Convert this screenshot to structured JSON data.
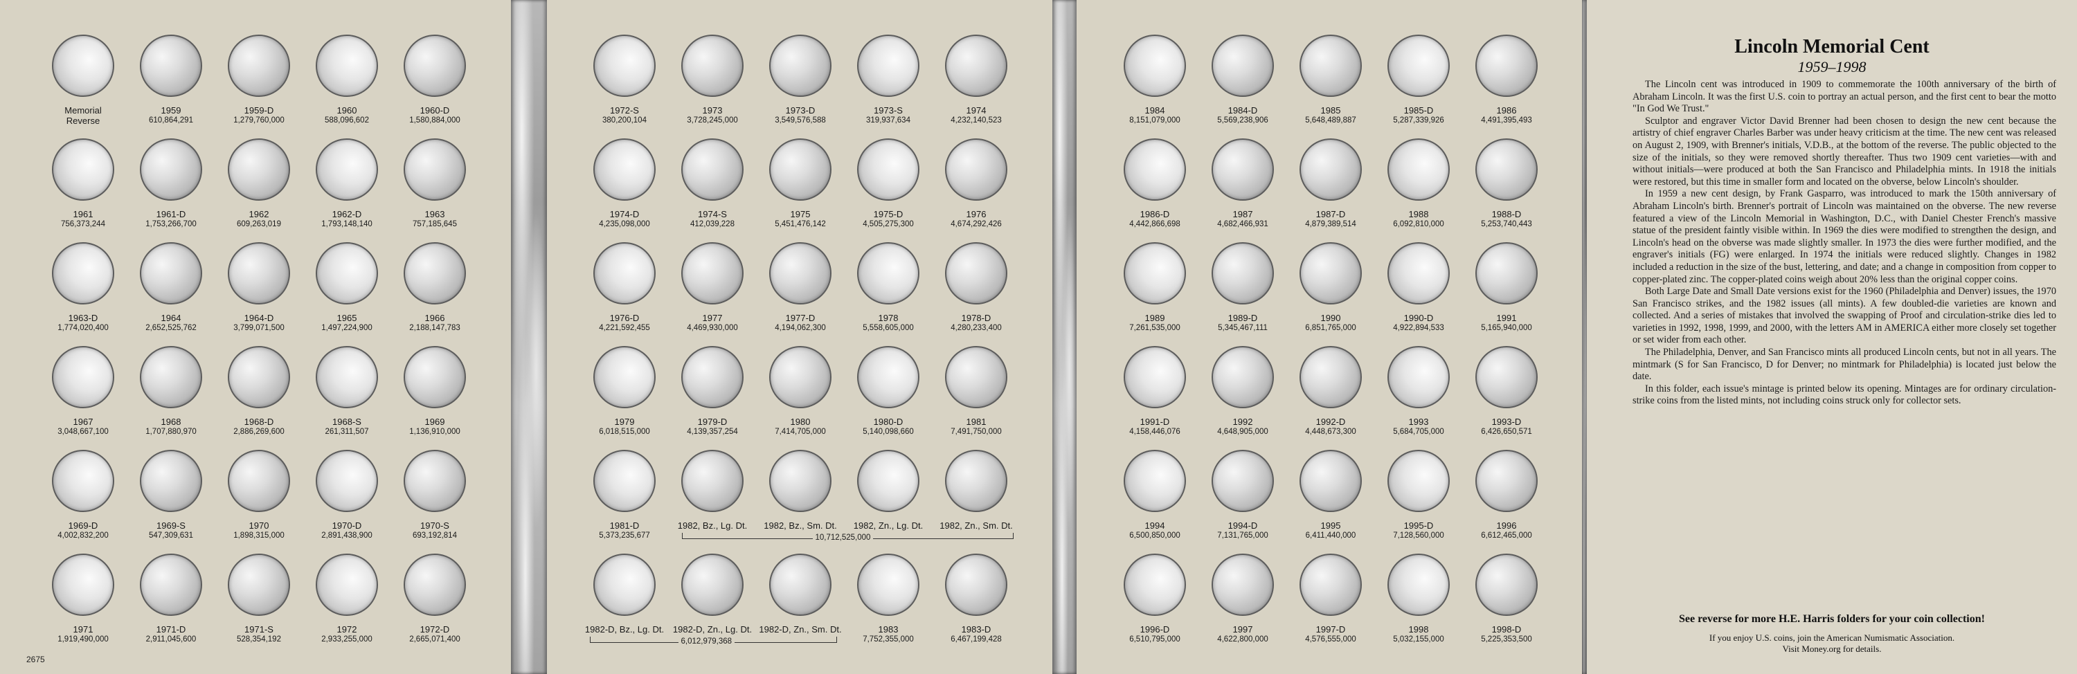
{
  "page_number": "2675",
  "panel1": [
    {
      "label": "Memorial\nReverse",
      "mintage": ""
    },
    {
      "label": "1959",
      "mintage": "610,864,291"
    },
    {
      "label": "1959-D",
      "mintage": "1,279,760,000"
    },
    {
      "label": "1960",
      "mintage": "588,096,602"
    },
    {
      "label": "1960-D",
      "mintage": "1,580,884,000"
    },
    {
      "label": "1961",
      "mintage": "756,373,244"
    },
    {
      "label": "1961-D",
      "mintage": "1,753,266,700"
    },
    {
      "label": "1962",
      "mintage": "609,263,019"
    },
    {
      "label": "1962-D",
      "mintage": "1,793,148,140"
    },
    {
      "label": "1963",
      "mintage": "757,185,645"
    },
    {
      "label": "1963-D",
      "mintage": "1,774,020,400"
    },
    {
      "label": "1964",
      "mintage": "2,652,525,762"
    },
    {
      "label": "1964-D",
      "mintage": "3,799,071,500"
    },
    {
      "label": "1965",
      "mintage": "1,497,224,900"
    },
    {
      "label": "1966",
      "mintage": "2,188,147,783"
    },
    {
      "label": "1967",
      "mintage": "3,048,667,100"
    },
    {
      "label": "1968",
      "mintage": "1,707,880,970"
    },
    {
      "label": "1968-D",
      "mintage": "2,886,269,600"
    },
    {
      "label": "1968-S",
      "mintage": "261,311,507"
    },
    {
      "label": "1969",
      "mintage": "1,136,910,000"
    },
    {
      "label": "1969-D",
      "mintage": "4,002,832,200"
    },
    {
      "label": "1969-S",
      "mintage": "547,309,631"
    },
    {
      "label": "1970",
      "mintage": "1,898,315,000"
    },
    {
      "label": "1970-D",
      "mintage": "2,891,438,900"
    },
    {
      "label": "1970-S",
      "mintage": "693,192,814"
    },
    {
      "label": "1971",
      "mintage": "1,919,490,000"
    },
    {
      "label": "1971-D",
      "mintage": "2,911,045,600"
    },
    {
      "label": "1971-S",
      "mintage": "528,354,192"
    },
    {
      "label": "1972",
      "mintage": "2,933,255,000"
    },
    {
      "label": "1972-D",
      "mintage": "2,665,071,400"
    }
  ],
  "panel2": [
    {
      "label": "1972-S",
      "mintage": "380,200,104"
    },
    {
      "label": "1973",
      "mintage": "3,728,245,000"
    },
    {
      "label": "1973-D",
      "mintage": "3,549,576,588"
    },
    {
      "label": "1973-S",
      "mintage": "319,937,634"
    },
    {
      "label": "1974",
      "mintage": "4,232,140,523"
    },
    {
      "label": "1974-D",
      "mintage": "4,235,098,000"
    },
    {
      "label": "1974-S",
      "mintage": "412,039,228"
    },
    {
      "label": "1975",
      "mintage": "5,451,476,142"
    },
    {
      "label": "1975-D",
      "mintage": "4,505,275,300"
    },
    {
      "label": "1976",
      "mintage": "4,674,292,426"
    },
    {
      "label": "1976-D",
      "mintage": "4,221,592,455"
    },
    {
      "label": "1977",
      "mintage": "4,469,930,000"
    },
    {
      "label": "1977-D",
      "mintage": "4,194,062,300"
    },
    {
      "label": "1978",
      "mintage": "5,558,605,000"
    },
    {
      "label": "1978-D",
      "mintage": "4,280,233,400"
    },
    {
      "label": "1979",
      "mintage": "6,018,515,000"
    },
    {
      "label": "1979-D",
      "mintage": "4,139,357,254"
    },
    {
      "label": "1980",
      "mintage": "7,414,705,000"
    },
    {
      "label": "1980-D",
      "mintage": "5,140,098,660"
    },
    {
      "label": "1981",
      "mintage": "7,491,750,000"
    },
    {
      "label": "1981-D",
      "mintage": "5,373,235,677"
    },
    {
      "label": "1982, Bz., Lg. Dt.",
      "mintage": ""
    },
    {
      "label": "1982, Bz., Sm. Dt.",
      "mintage": ""
    },
    {
      "label": "1982, Zn., Lg. Dt.",
      "mintage": ""
    },
    {
      "label": "1982, Zn., Sm. Dt.",
      "mintage": ""
    },
    {
      "label": "1982-D, Bz., Lg. Dt.",
      "mintage": ""
    },
    {
      "label": "1982-D, Zn., Lg. Dt.",
      "mintage": ""
    },
    {
      "label": "1982-D, Zn., Sm. Dt.",
      "mintage": ""
    },
    {
      "label": "1983",
      "mintage": "7,752,355,000"
    },
    {
      "label": "1983-D",
      "mintage": "6,467,199,428"
    }
  ],
  "bracket_1982": "10,712,525,000",
  "bracket_1982d": "6,012,979,368",
  "panel3": [
    {
      "label": "1984",
      "mintage": "8,151,079,000"
    },
    {
      "label": "1984-D",
      "mintage": "5,569,238,906"
    },
    {
      "label": "1985",
      "mintage": "5,648,489,887"
    },
    {
      "label": "1985-D",
      "mintage": "5,287,339,926"
    },
    {
      "label": "1986",
      "mintage": "4,491,395,493"
    },
    {
      "label": "1986-D",
      "mintage": "4,442,866,698"
    },
    {
      "label": "1987",
      "mintage": "4,682,466,931"
    },
    {
      "label": "1987-D",
      "mintage": "4,879,389,514"
    },
    {
      "label": "1988",
      "mintage": "6,092,810,000"
    },
    {
      "label": "1988-D",
      "mintage": "5,253,740,443"
    },
    {
      "label": "1989",
      "mintage": "7,261,535,000"
    },
    {
      "label": "1989-D",
      "mintage": "5,345,467,111"
    },
    {
      "label": "1990",
      "mintage": "6,851,765,000"
    },
    {
      "label": "1990-D",
      "mintage": "4,922,894,533"
    },
    {
      "label": "1991",
      "mintage": "5,165,940,000"
    },
    {
      "label": "1991-D",
      "mintage": "4,158,446,076"
    },
    {
      "label": "1992",
      "mintage": "4,648,905,000"
    },
    {
      "label": "1992-D",
      "mintage": "4,448,673,300"
    },
    {
      "label": "1993",
      "mintage": "5,684,705,000"
    },
    {
      "label": "1993-D",
      "mintage": "6,426,650,571"
    },
    {
      "label": "1994",
      "mintage": "6,500,850,000"
    },
    {
      "label": "1994-D",
      "mintage": "7,131,765,000"
    },
    {
      "label": "1995",
      "mintage": "6,411,440,000"
    },
    {
      "label": "1995-D",
      "mintage": "7,128,560,000"
    },
    {
      "label": "1996",
      "mintage": "6,612,465,000"
    },
    {
      "label": "1996-D",
      "mintage": "6,510,795,000"
    },
    {
      "label": "1997",
      "mintage": "4,622,800,000"
    },
    {
      "label": "1997-D",
      "mintage": "4,576,555,000"
    },
    {
      "label": "1998",
      "mintage": "5,032,155,000"
    },
    {
      "label": "1998-D",
      "mintage": "5,225,353,500"
    }
  ],
  "info": {
    "title": "Lincoln Memorial Cent",
    "subtitle": "1959–1998",
    "paragraphs": [
      "The Lincoln cent was introduced in 1909 to commemorate the 100th anniversary of the birth of Abraham Lincoln. It was the first U.S. coin to portray an actual person, and the first cent to bear the motto \"In God We Trust.\"",
      "Sculptor and engraver Victor David Brenner had been chosen to design the new cent because the artistry of chief engraver Charles Barber was under heavy criticism at the time. The new cent was released on August 2, 1909, with Brenner's initials, V.D.B., at the bottom of the reverse. The public objected to the size of the initials, so they were removed shortly thereafter. Thus two 1909 cent varieties—with and without initials—were produced at both the San Francisco and Philadelphia mints. In 1918 the initials were restored, but this time in smaller form and located on the obverse, below Lincoln's shoulder.",
      "In 1959 a new cent design, by Frank Gasparro, was introduced to mark the 150th anniversary of Abraham Lincoln's birth. Brenner's portrait of Lincoln was maintained on the obverse. The new reverse featured a view of the Lincoln Memorial in Washington, D.C., with Daniel Chester French's massive statue of the president faintly visible within. In 1969 the dies were modified to strengthen the design, and Lincoln's head on the obverse was made slightly smaller. In 1973 the dies were further modified, and the engraver's initials (FG) were enlarged. In 1974 the initials were reduced slightly. Changes in 1982 included a reduction in the size of the bust, lettering, and date; and a change in composition from copper to copper-plated zinc. The copper-plated coins weigh about 20% less than the original copper coins.",
      "Both Large Date and Small Date versions exist for the 1960 (Philadelphia and Denver) issues, the 1970 San Francisco strikes, and the 1982 issues (all mints). A few doubled-die varieties are known and collected. And a series of mistakes that involved the swapping of Proof and circulation-strike dies led to varieties in 1992, 1998, 1999, and 2000, with the letters AM in AMERICA either more closely set together or set wider from each other.",
      "The Philadelphia, Denver, and San Francisco mints all produced Lincoln cents, but not in all years. The mintmark (S for San Francisco, D for Denver; no mintmark for Philadelphia) is located just below the date.",
      "In this folder, each issue's mintage is printed below its opening. Mintages are for ordinary circulation-strike coins from the listed mints, not including coins struck only for collector sets."
    ],
    "see_reverse": "See reverse for more H.E. Harris folders for your coin collection!",
    "ana_line1": "If you enjoy U.S. coins, join the American Numismatic Association.",
    "ana_line2": "Visit Money.org for details."
  }
}
